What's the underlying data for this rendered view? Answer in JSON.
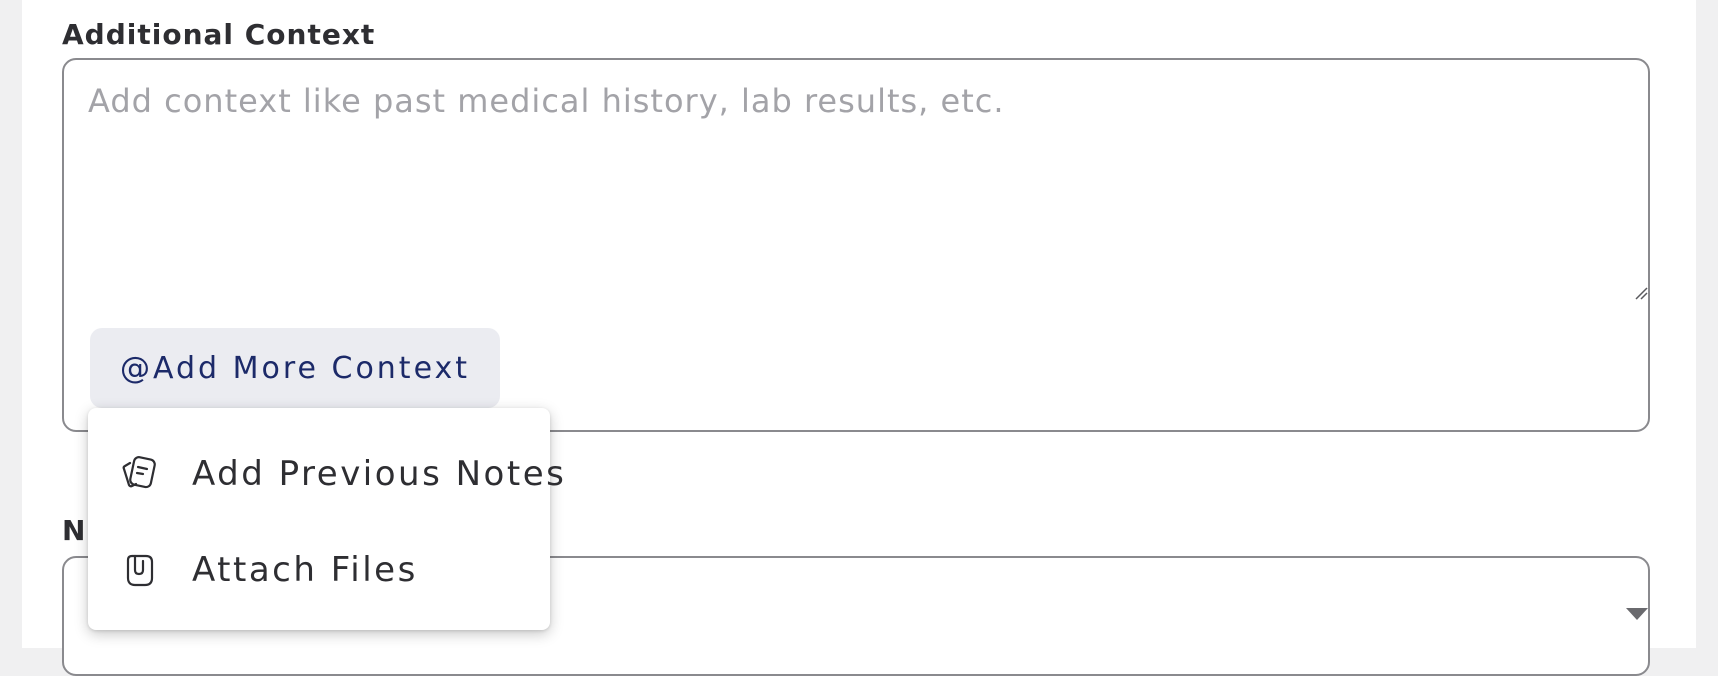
{
  "form": {
    "additional_context_label": "Additional Context",
    "textarea_placeholder": "Add context like past medical history, lab results, etc.",
    "add_more_context_label": "@Add More Context",
    "next_field_label_partial": "N"
  },
  "menu": {
    "items": [
      {
        "label": "Add Previous Notes",
        "icon": "notes-icon"
      },
      {
        "label": "Attach Files",
        "icon": "attach-icon"
      }
    ]
  },
  "colors": {
    "accent": "#1c2a69",
    "button_bg": "#ebecf1",
    "border": "#8a8a8e",
    "placeholder": "#a3a3a8"
  }
}
